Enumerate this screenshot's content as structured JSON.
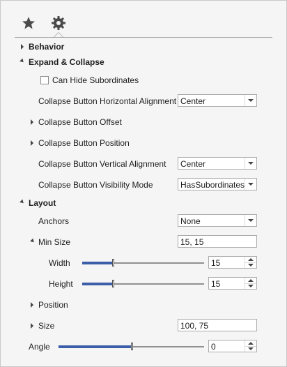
{
  "tabs": [
    {
      "icon": "star-icon",
      "label": ""
    },
    {
      "icon": "gear-icon",
      "label": ""
    }
  ],
  "accent_color": "#3c5ea8",
  "sections": {
    "behavior": {
      "label": "Behavior",
      "expanded": false
    },
    "expand_collapse": {
      "label": "Expand & Collapse",
      "expanded": true,
      "can_hide_subordinates": {
        "label": "Can Hide Subordinates",
        "checked": false
      },
      "h_align": {
        "label": "Collapse Button Horizontal Alignment",
        "value": "Center"
      },
      "offset": {
        "label": "Collapse Button Offset"
      },
      "position": {
        "label": "Collapse Button Position"
      },
      "v_align": {
        "label": "Collapse Button Vertical Alignment",
        "value": "Center"
      },
      "visibility": {
        "label": "Collapse Button Visibility Mode",
        "value": "HasSubordinates"
      }
    },
    "layout": {
      "label": "Layout",
      "expanded": true,
      "anchors": {
        "label": "Anchors",
        "value": "None"
      },
      "min_size": {
        "label": "Min Size",
        "value": "15, 15"
      },
      "width": {
        "label": "Width",
        "value": "15",
        "slider_fraction": 0.25
      },
      "height": {
        "label": "Height",
        "value": "15",
        "slider_fraction": 0.25
      },
      "position": {
        "label": "Position"
      },
      "size": {
        "label": "Size",
        "value": "100, 75"
      }
    },
    "angle": {
      "label": "Angle",
      "value": "0",
      "slider_fraction": 0.5
    }
  }
}
